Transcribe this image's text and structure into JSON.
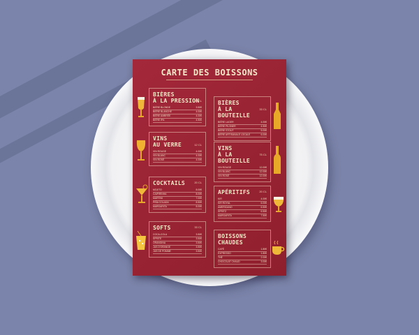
{
  "menu_title": "CARTE DES BOISSONS",
  "sections": [
    {
      "title": [
        "BIÈRES",
        "À LA PRESSION"
      ],
      "volume": "25 CL",
      "items": [
        [
          "BIÈRE BLONDE",
          "3.50€"
        ],
        [
          "BIÈRE BLANCHE",
          "4.00€"
        ],
        [
          "BIÈRE AMBRÉE",
          "4.00€"
        ],
        [
          "BIÈRE IPA",
          "4.50€"
        ]
      ]
    },
    {
      "title": [
        "BIÈRES",
        "À LA BOUTEILLE"
      ],
      "volume": "33 CL",
      "items": [
        [
          "BIÈRE LAGER",
          "4.00€"
        ],
        [
          "BIÈRE PILSNER",
          "4.50€"
        ],
        [
          "BIÈRE STOUT",
          "5.00€"
        ],
        [
          "BIÈRE ARTISANALE LOCALE",
          "6.00€"
        ]
      ]
    },
    {
      "title": [
        "VINS",
        "AU VERRE"
      ],
      "volume": "12 CL",
      "items": [
        [
          "VIN ROUGE",
          "4.00€"
        ],
        [
          "VIN BLANC",
          "4.00€"
        ],
        [
          "VIN ROSÉ",
          "4.00€"
        ]
      ]
    },
    {
      "title": [
        "VINS",
        "À LA BOUTEILLE"
      ],
      "volume": "75 CL",
      "items": [
        [
          "VIN ROUGE",
          "12.00€"
        ],
        [
          "VIN BLANC",
          "12.00€"
        ],
        [
          "VIN ROSÉ",
          "12.00€"
        ]
      ]
    },
    {
      "title": [
        "COCKTAILS"
      ],
      "volume": "20 CL",
      "items": [
        [
          "MOJITO",
          "8.00€"
        ],
        [
          "CAIPIRINHA",
          "8.00€"
        ],
        [
          "MARTINI",
          "7.00€"
        ],
        [
          "PIÑA COLADA",
          "8.50€"
        ],
        [
          "MARGARITA",
          "8.00€"
        ]
      ]
    },
    {
      "title": [
        "APÉRITIFS"
      ],
      "volume": "20 CL",
      "items": [
        [
          "KIR",
          "4.00€"
        ],
        [
          "KIR ROYAL",
          "6.00€"
        ],
        [
          "AMERICANO",
          "6.50€"
        ],
        [
          "SPRITZ",
          "6.50€"
        ],
        [
          "MARGARITA",
          "7.50€"
        ]
      ]
    },
    {
      "title": [
        "SOFTS"
      ],
      "volume": "33 CL",
      "items": [
        [
          "COCA-COLA",
          "3.50€"
        ],
        [
          "SPRITE",
          "3.50€"
        ],
        [
          "ORANGINA",
          "3.50€"
        ],
        [
          "JUS D'ORANGE",
          "3.50€"
        ],
        [
          "JUS DE POMME",
          "3.50€"
        ]
      ]
    },
    {
      "title": [
        "BOISSONS",
        "CHAUDES"
      ],
      "volume": "",
      "items": [
        [
          "CAFÉ",
          "1.80€"
        ],
        [
          "EXPRESSO",
          "1.80€"
        ],
        [
          "THÉ",
          "2.00€"
        ],
        [
          "CHOCOLAT CHAUD",
          "3.00€"
        ]
      ]
    }
  ],
  "colors": {
    "card": "#9b2331",
    "accent": "#e9a928",
    "text": "#f6e9c8"
  }
}
